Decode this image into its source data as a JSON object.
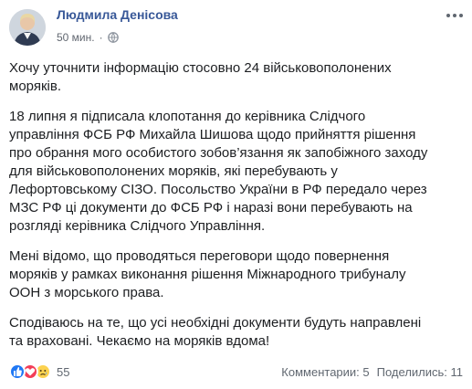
{
  "post": {
    "author": "Людмила Денісова",
    "time": "50 мин.",
    "separator": "·",
    "privacy_icon": "globe-icon",
    "menu_icon": "more-horizontal-icon",
    "paragraphs": [
      "Хочу уточнити інформацію стосовно 24 військовополонених моряків.",
      "18 липня я підписала клопотання до керівника Слідчого управління ФСБ РФ Михайла Шишова щодо прийняття рішення про обрання мого особистого зобов’язання як запобіжного заходу для військовополонених моряків, які перебувають у Лефортовському СІЗО. Посольство України в РФ передало через МЗС РФ ці документи до ФСБ РФ і наразі вони перебувають на розгляді керівника Слідчого Управління.",
      "Мені відомо, що проводяться переговори щодо повернення моряків у рамках виконання рішення Міжнародного трибуналу ООН з морського права.",
      "Сподіваюсь на те, що усі необхідні документи будуть направлені та враховані. Чекаємо на моряків вдома!"
    ]
  },
  "footer": {
    "reactions": [
      "like-icon",
      "love-icon",
      "sad-icon"
    ],
    "reaction_count": "55",
    "comments": "Комментарии: 5",
    "shares": "Поделились: 11"
  },
  "colors": {
    "author_link": "#385898",
    "meta_text": "#616770",
    "like": "#2078f4",
    "love": "#f33e58",
    "sad": "#fcd24f"
  }
}
